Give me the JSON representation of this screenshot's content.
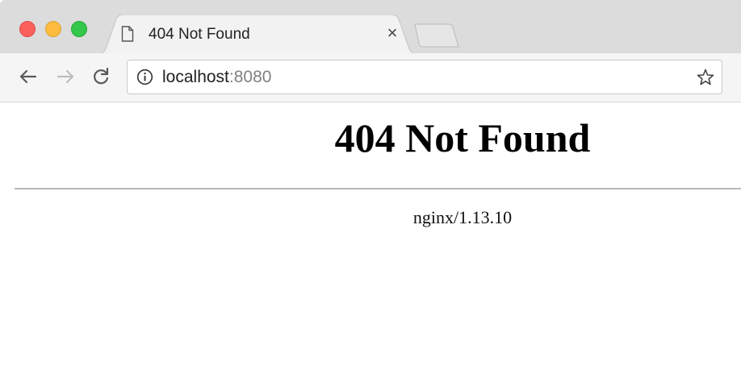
{
  "tab": {
    "title": "404 Not Found",
    "close_glyph": "×",
    "icon": "document-icon"
  },
  "toolbar": {
    "back_icon": "back-arrow-icon",
    "forward_icon": "forward-arrow-icon",
    "reload_icon": "reload-icon",
    "url_host": "localhost",
    "url_port": ":8080",
    "info_icon": "info-icon",
    "bookmark_icon": "star-icon"
  },
  "window_controls": {
    "close_color": "#fc605c",
    "minimize_color": "#fdbc40",
    "maximize_color": "#34c84a"
  },
  "page": {
    "heading": "404 Not Found",
    "server_signature": "nginx/1.13.10"
  }
}
